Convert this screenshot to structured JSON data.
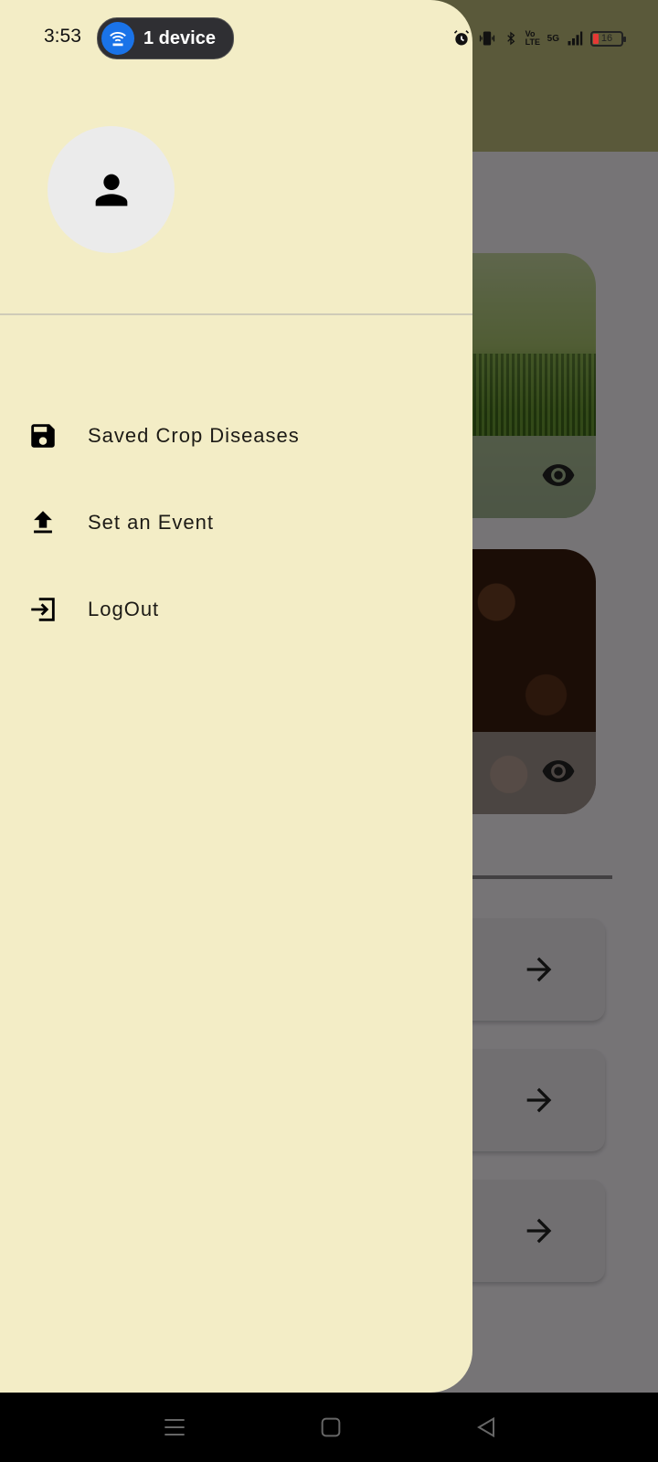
{
  "status_bar": {
    "time": "3:53",
    "device_pill": "1 device",
    "network_badges": [
      "Vo LTE",
      "5G"
    ],
    "battery": "16",
    "colors": {
      "battery_low": "#e53935",
      "pill_accent": "#1a73e8"
    }
  },
  "drawer": {
    "avatar_icon": "person-icon",
    "items": [
      {
        "label": "Saved Crop Diseases",
        "icon": "save-icon"
      },
      {
        "label": "Set an Event",
        "icon": "upload-icon"
      },
      {
        "label": "LogOut",
        "icon": "logout-icon"
      }
    ],
    "colors": {
      "background": "#f3edc6"
    }
  },
  "background_screen": {
    "cards": [
      {
        "image": "grass-field",
        "action_icon": "eye-icon"
      },
      {
        "image": "coffee-beans",
        "action_icon": "eye-icon"
      }
    ],
    "list_items": [
      {
        "action_icon": "arrow-right-icon"
      },
      {
        "action_icon": "arrow-right-icon"
      },
      {
        "action_icon": "arrow-right-icon"
      }
    ]
  },
  "nav_bar": {
    "buttons": [
      "menu-icon",
      "home-icon",
      "back-icon"
    ]
  }
}
